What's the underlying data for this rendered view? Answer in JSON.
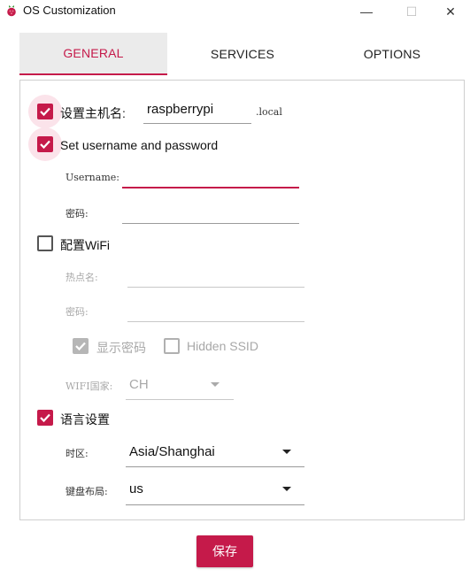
{
  "window": {
    "title": "OS Customization",
    "minimize": "—",
    "maximize": "☐",
    "close": "✕"
  },
  "tabs": [
    {
      "label": "GENERAL",
      "active": true
    },
    {
      "label": "SERVICES",
      "active": false
    },
    {
      "label": "OPTIONS",
      "active": false
    }
  ],
  "general": {
    "hostname": {
      "checked": true,
      "label": "设置主机名:",
      "value": "raspberrypi",
      "suffix": ".local"
    },
    "user": {
      "checked": true,
      "label": "Set username and password",
      "username_label": "Username:",
      "username_value": "",
      "password_label": "密码:",
      "password_value": ""
    },
    "wifi": {
      "checked": false,
      "label": "配置WiFi",
      "ssid_label": "热点名:",
      "ssid_value": "",
      "password_label": "密码:",
      "password_value": "",
      "show_password_checked": true,
      "show_password_label": "显示密码",
      "hidden_ssid_checked": false,
      "hidden_ssid_label": "Hidden SSID",
      "country_label": "WIFI国家:",
      "country_value": "CH"
    },
    "locale": {
      "checked": true,
      "label": "语言设置",
      "timezone_label": "时区:",
      "timezone_value": "Asia/Shanghai",
      "keyboard_label": "键盘布局:",
      "keyboard_value": "us"
    }
  },
  "save_label": "保存",
  "colors": {
    "accent": "#c51a4a",
    "disabled": "#a8a8a8"
  },
  "icons": {
    "app": "raspberry-icon",
    "check": "check-icon",
    "dropdown": "caret-down-icon"
  }
}
